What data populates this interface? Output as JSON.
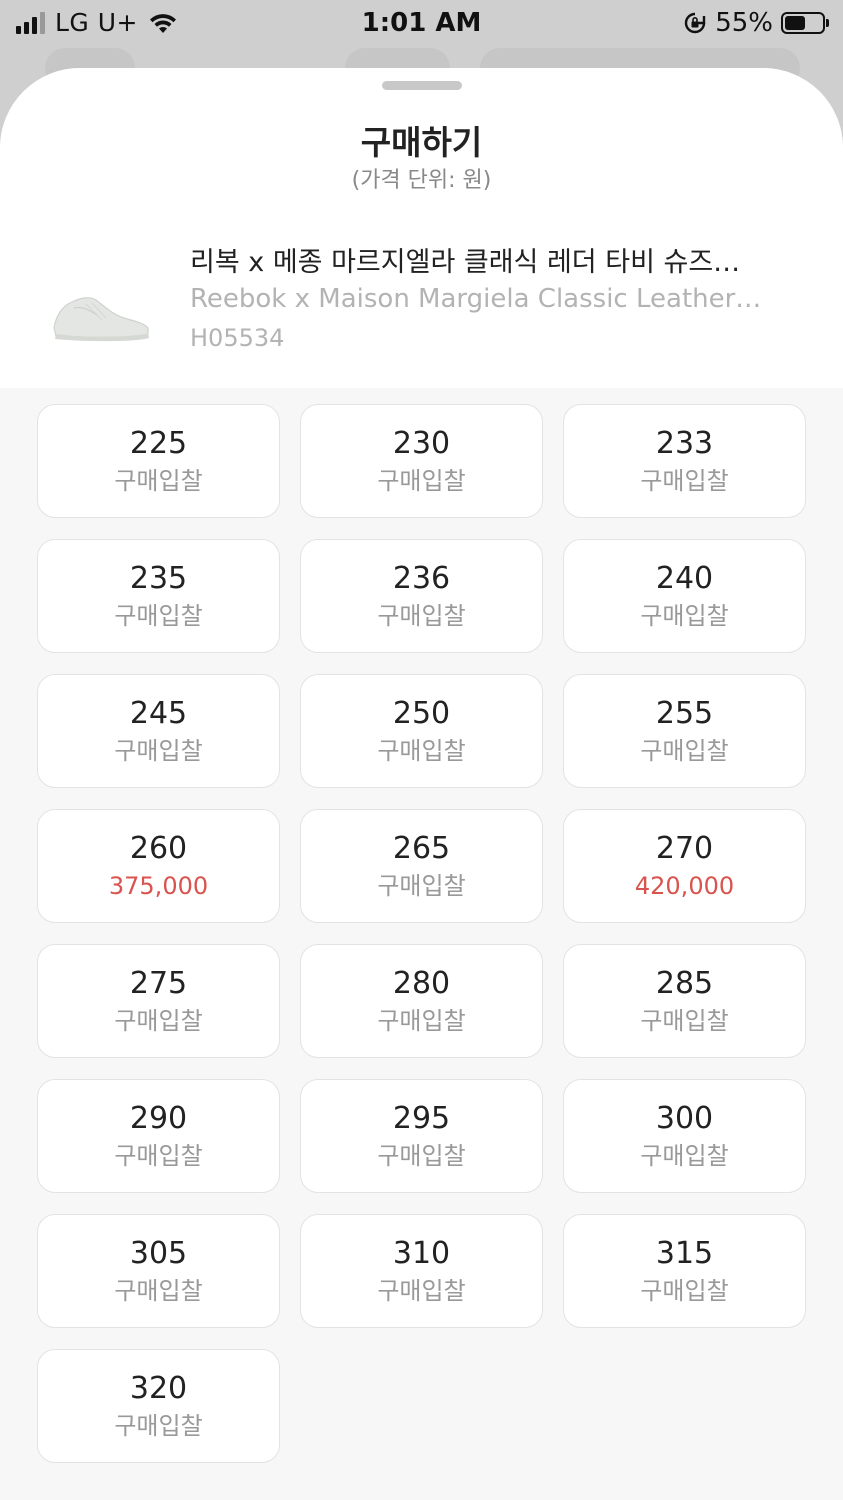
{
  "status_bar": {
    "carrier": "LG U+",
    "time": "1:01 AM",
    "battery": "55%",
    "battery_level": 0.55
  },
  "sheet": {
    "title": "구매하기",
    "subtitle": "(가격 단위: 원)"
  },
  "product": {
    "name_ko": "리복 x 메종 마르지엘라 클래식 레더 타비 슈즈…",
    "name_en": "Reebok x Maison Margiela Classic Leather…",
    "code": "H05534"
  },
  "colors": {
    "price_red": "#d9534f",
    "placeholder_gray": "#999999"
  },
  "sizes": [
    {
      "size": "225",
      "price": "구매입찰",
      "has_price": false
    },
    {
      "size": "230",
      "price": "구매입찰",
      "has_price": false
    },
    {
      "size": "233",
      "price": "구매입찰",
      "has_price": false
    },
    {
      "size": "235",
      "price": "구매입찰",
      "has_price": false
    },
    {
      "size": "236",
      "price": "구매입찰",
      "has_price": false
    },
    {
      "size": "240",
      "price": "구매입찰",
      "has_price": false
    },
    {
      "size": "245",
      "price": "구매입찰",
      "has_price": false
    },
    {
      "size": "250",
      "price": "구매입찰",
      "has_price": false
    },
    {
      "size": "255",
      "price": "구매입찰",
      "has_price": false
    },
    {
      "size": "260",
      "price": "375,000",
      "has_price": true
    },
    {
      "size": "265",
      "price": "구매입찰",
      "has_price": false
    },
    {
      "size": "270",
      "price": "420,000",
      "has_price": true
    },
    {
      "size": "275",
      "price": "구매입찰",
      "has_price": false
    },
    {
      "size": "280",
      "price": "구매입찰",
      "has_price": false
    },
    {
      "size": "285",
      "price": "구매입찰",
      "has_price": false
    },
    {
      "size": "290",
      "price": "구매입찰",
      "has_price": false
    },
    {
      "size": "295",
      "price": "구매입찰",
      "has_price": false
    },
    {
      "size": "300",
      "price": "구매입찰",
      "has_price": false
    },
    {
      "size": "305",
      "price": "구매입찰",
      "has_price": false
    },
    {
      "size": "310",
      "price": "구매입찰",
      "has_price": false
    },
    {
      "size": "315",
      "price": "구매입찰",
      "has_price": false
    },
    {
      "size": "320",
      "price": "구매입찰",
      "has_price": false
    }
  ]
}
